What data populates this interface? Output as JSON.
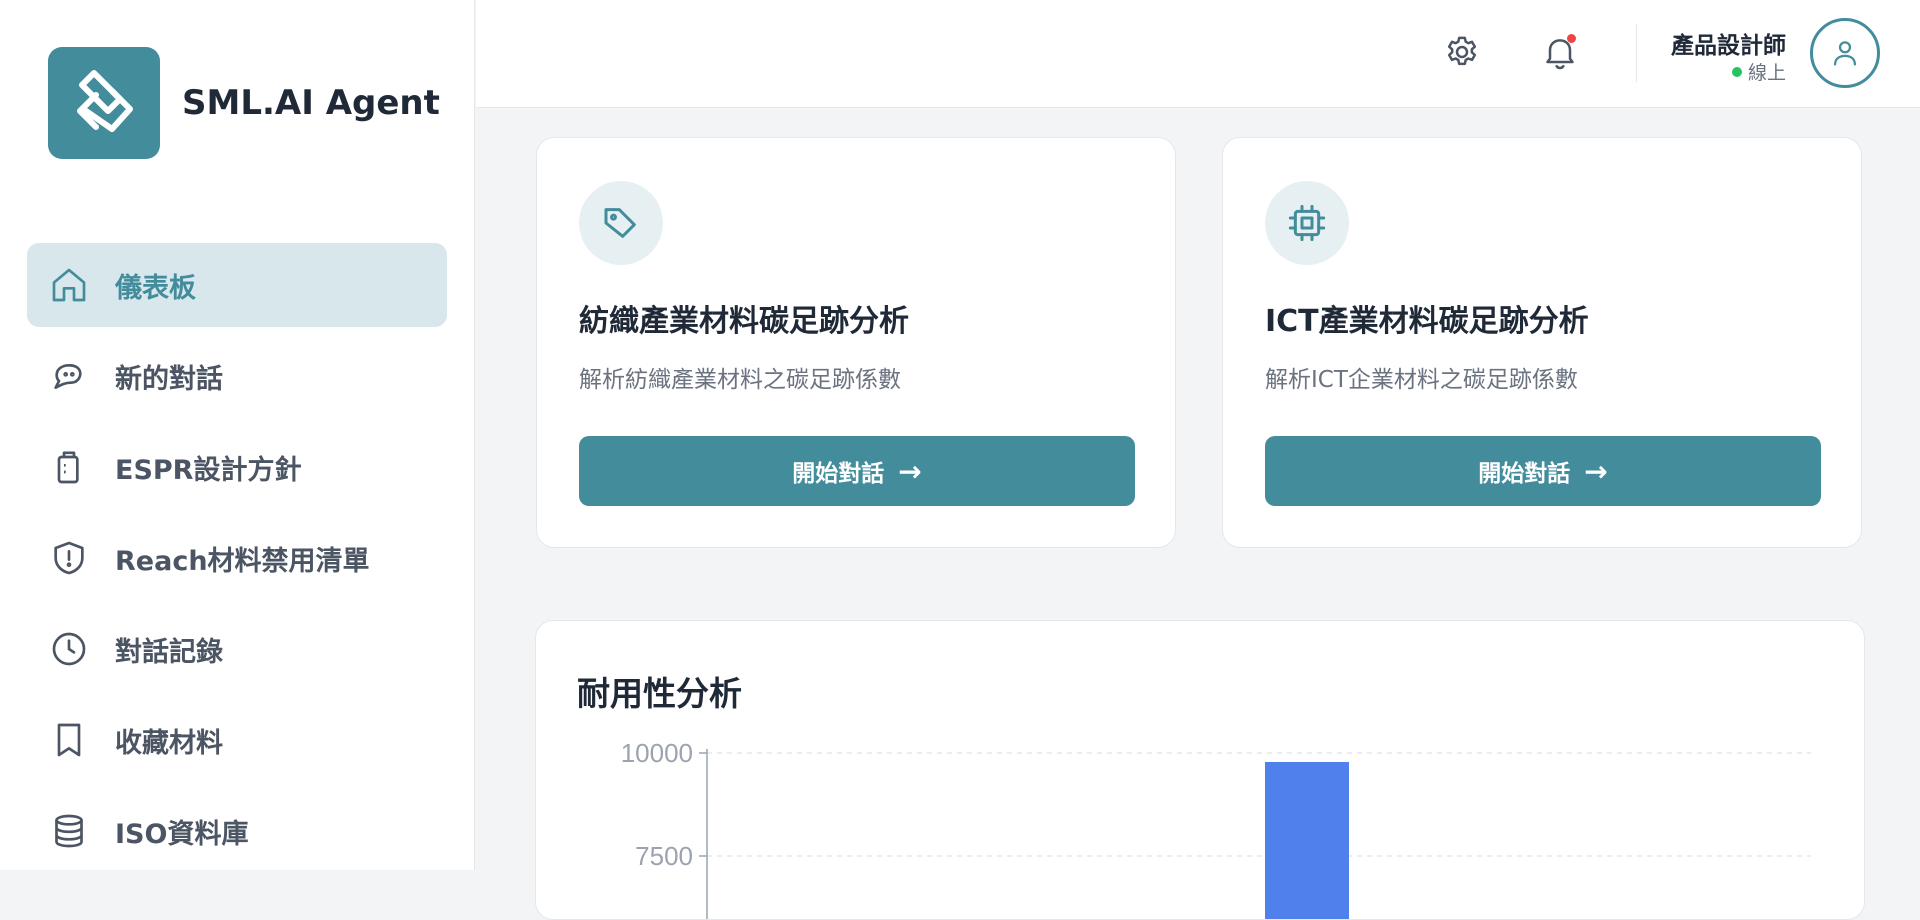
{
  "brand": {
    "name": "SML.AI Agent",
    "accent": "#438c9c"
  },
  "sidebar": {
    "items": [
      {
        "label": "儀表板",
        "icon": "home-icon",
        "active": true
      },
      {
        "label": "新的對話",
        "icon": "chat-bubble-icon",
        "active": false
      },
      {
        "label": "ESPR設計方針",
        "icon": "clipboard-icon",
        "active": false
      },
      {
        "label": "Reach材料禁用清單",
        "icon": "shield-alert-icon",
        "active": false
      },
      {
        "label": "對話記錄",
        "icon": "clock-icon",
        "active": false
      },
      {
        "label": "收藏材料",
        "icon": "bookmark-icon",
        "active": false
      },
      {
        "label": "ISO資料庫",
        "icon": "database-icon",
        "active": false
      }
    ]
  },
  "topbar": {
    "settings_icon": "gear-icon",
    "notification_icon": "bell-icon",
    "user": {
      "name": "產品設計師",
      "status": "線上",
      "status_color": "#22c55e"
    }
  },
  "cards": [
    {
      "icon": "tag-icon",
      "title": "紡織產業材料碳足跡分析",
      "description": "解析紡織產業材料之碳足跡係數",
      "button_label": "開始對話",
      "button_arrow": "→"
    },
    {
      "icon": "chip-icon",
      "title": "ICT產業材料碳足跡分析",
      "description": "解析ICT企業材料之碳足跡係數",
      "button_label": "開始對話",
      "button_arrow": "→"
    }
  ],
  "durability": {
    "title": "耐用性分析"
  },
  "chart_data": {
    "type": "bar",
    "title": "耐用性分析",
    "y_ticks": [
      10000,
      7500
    ],
    "ylim_visible": [
      7500,
      10000
    ],
    "bar_color": "#4f80ec",
    "values": [
      10000
    ],
    "grid": true
  }
}
